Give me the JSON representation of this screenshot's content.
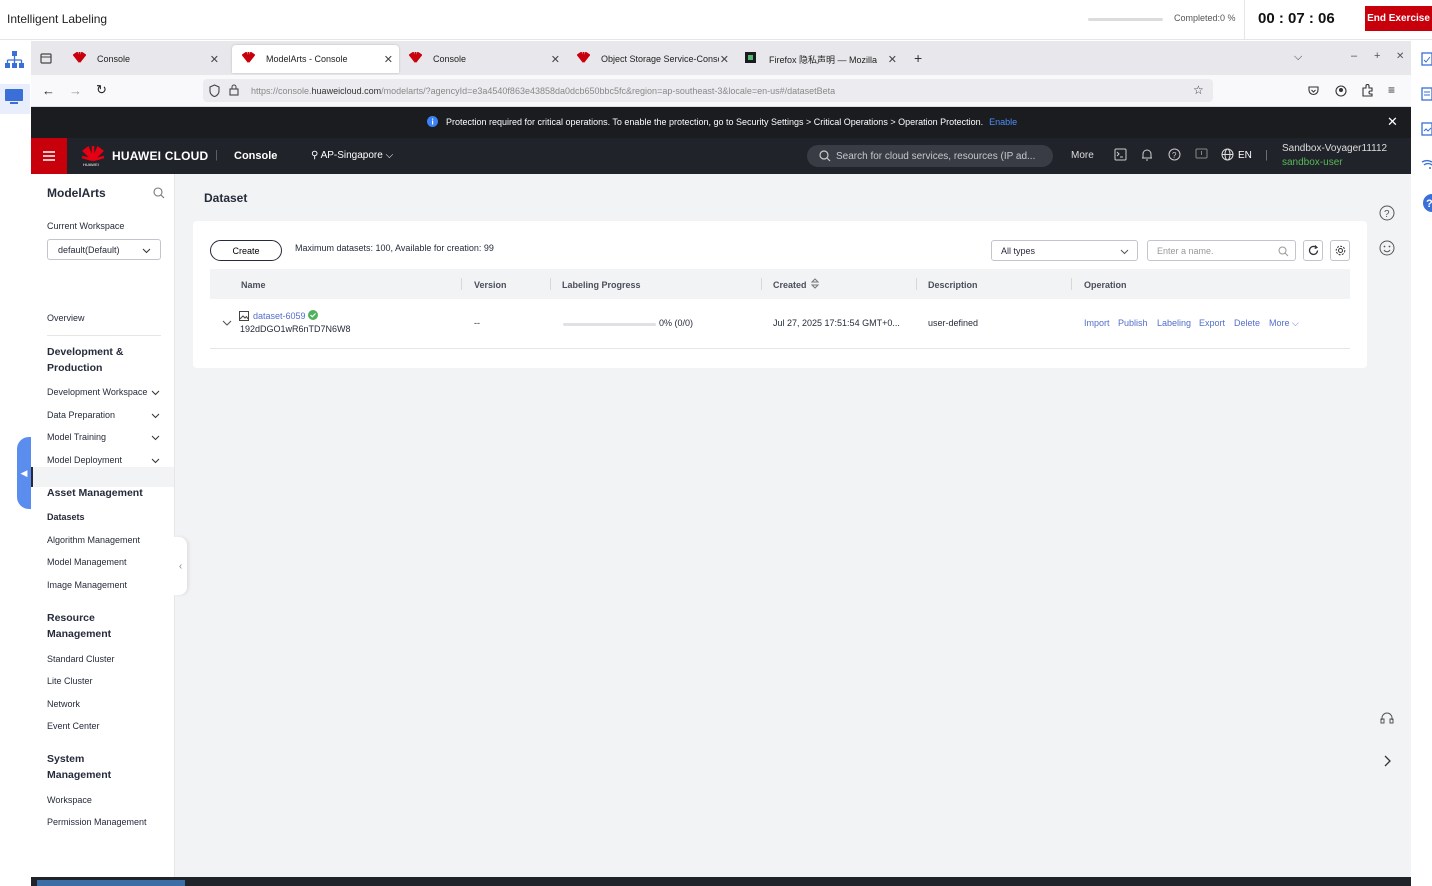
{
  "exercise": {
    "title": "Intelligent Labeling",
    "completed_label": "Completed:0 %",
    "progress_fraction": 0,
    "timer": "00 : 07 : 06",
    "end_button": "End Exercise"
  },
  "browser": {
    "tabs": [
      {
        "label": "Console",
        "active": false
      },
      {
        "label": "ModelArts - Console",
        "active": true
      },
      {
        "label": "Console",
        "active": false
      },
      {
        "label": "Object Storage Service-Conso",
        "active": false
      },
      {
        "label": "Firefox 隐私声明 — Mozilla",
        "active": false
      }
    ],
    "url_prefix": "https://console.",
    "url_domain": "huaweicloud.com",
    "url_rest": "/modelarts/?agencyId=e3a4540f863e43858da0dcb650bbc5fc&region=ap-southeast-3&locale=en-us#/datasetBeta"
  },
  "notice": {
    "text": "Protection required for critical operations. To enable the protection, go to Security Settings > Critical Operations > Operation Protection.",
    "enable": "Enable"
  },
  "header": {
    "brand": "HUAWEI CLOUD",
    "console": "Console",
    "region": "AP-Singapore",
    "search_placeholder": "Search for cloud services, resources (IP ad...",
    "more": "More",
    "lang": "EN",
    "user": "Sandbox-Voyager11112",
    "user_sub": "sandbox-user",
    "colors": {
      "brand_red": "#c7000b",
      "user_green": "#58b957"
    }
  },
  "sidebar": {
    "service": "ModelArts",
    "workspace_label": "Current Workspace",
    "workspace_value": "default(Default)",
    "overview": "Overview",
    "dev_group": "Development & Production",
    "dev_items": [
      "Development Workspace",
      "Data Preparation",
      "Model Training",
      "Model Deployment"
    ],
    "asset_group": "Asset Management",
    "asset_items": [
      "Datasets",
      "Algorithm Management",
      "Model Management",
      "Image Management"
    ],
    "resource_group": "Resource Management",
    "resource_items": [
      "Standard Cluster",
      "Lite Cluster",
      "Network",
      "Event Center"
    ],
    "system_group": "System Management",
    "system_items": [
      "Workspace",
      "Permission Management"
    ]
  },
  "main": {
    "title": "Dataset",
    "create": "Create",
    "limit": "Maximum datasets: 100, Available for creation: 99",
    "type_filter": "All types",
    "name_placeholder": "Enter a name.",
    "columns": [
      "Name",
      "Version",
      "Labeling Progress",
      "Created",
      "Description",
      "Operation"
    ],
    "rows": [
      {
        "name": "dataset-6059",
        "id": "192dDGO1wR6nTD7N6W8",
        "version": "--",
        "progress_text": "0% (0/0)",
        "progress_fraction": 0,
        "created": "Jul 27, 2025 17:51:54 GMT+0...",
        "description": "user-defined",
        "ops": [
          "Import",
          "Publish",
          "Labeling",
          "Export",
          "Delete",
          "More"
        ]
      }
    ]
  }
}
